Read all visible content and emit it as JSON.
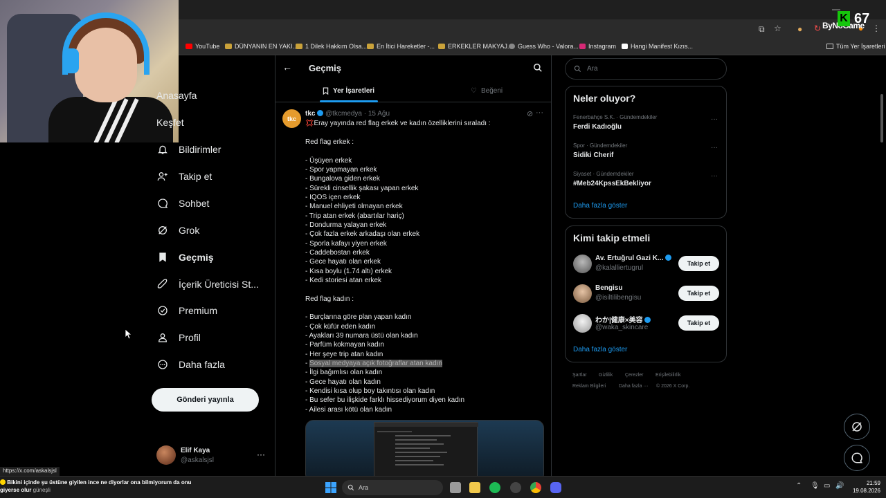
{
  "browser": {
    "bookmarks": [
      {
        "label": "YouTube",
        "color": "#ff0000"
      },
      {
        "label": "DÜNYANIN EN YAKI...",
        "color": "#caa23a"
      },
      {
        "label": "1 Dilek Hakkım Olsa...",
        "color": "#caa23a"
      },
      {
        "label": "En İtici Hareketler -...",
        "color": "#caa23a"
      },
      {
        "label": "ERKEKLER MAKYAJ...",
        "color": "#caa23a"
      },
      {
        "label": "Guess Who - Valora...",
        "color": "#888888"
      },
      {
        "label": "Instagram",
        "color": "#d62976"
      },
      {
        "label": "Hangi Manifest Kızıs...",
        "color": "#ffffff"
      }
    ],
    "all_bookmarks": "Tüm Yer İşaretleri",
    "status_url": "https://x.com/askalsjsl"
  },
  "overlay": {
    "brand": "ByNoGame",
    "score": "67"
  },
  "nav": {
    "items": [
      {
        "label": "Anasayfa",
        "icon": "home-icon"
      },
      {
        "label": "Keşfet",
        "icon": "search-icon"
      },
      {
        "label": "Bildirimler",
        "icon": "bell-icon"
      },
      {
        "label": "Takip et",
        "icon": "person-plus-icon"
      },
      {
        "label": "Sohbet",
        "icon": "chat-icon"
      },
      {
        "label": "Grok",
        "icon": "grok-icon"
      },
      {
        "label": "Geçmiş",
        "icon": "bookmark-icon"
      },
      {
        "label": "İçerik Üreticisi St...",
        "icon": "rocket-icon"
      },
      {
        "label": "Premium",
        "icon": "verified-icon"
      },
      {
        "label": "Profil",
        "icon": "person-icon"
      },
      {
        "label": "Daha fazla",
        "icon": "more-circle-icon"
      }
    ],
    "post_button": "Gönderi yayınla",
    "account": {
      "name": "Elif Kaya",
      "handle": "@askalsjsl"
    }
  },
  "main": {
    "title": "Geçmiş",
    "tabs": [
      "Yer İşaretleri",
      "Beğeni"
    ],
    "post": {
      "avatar_text": "tkc",
      "author": "tkc",
      "handle": "@tkcmedya",
      "date": "15 Ağu",
      "headline": "Eray yayında red flag erkek ve kadın özelliklerini sıraladı :",
      "section_men": "Red flag erkek :",
      "men": [
        "- Üşüyen erkek",
        "- Spor yapmayan erkek",
        "- Bungalova giden erkek",
        "- Sürekli cinsellik şakası yapan erkek",
        "- IQOS içen erkek",
        "- Manuel ehliyeti olmayan erkek",
        "- Trip atan erkek (abartılar hariç)",
        "- Dondurma yalayan erkek",
        "- Çok fazla erkek arkadaşı olan erkek",
        "- Sporla kafayı yiyen erkek",
        "- Caddebostan erkek",
        "- Gece hayatı olan erkek",
        "- Kısa boylu (1.74 altı) erkek",
        "- Kedi storiesi atan erkek"
      ],
      "section_women": "Red flag kadın :",
      "women": [
        "- Burçlarına göre plan yapan kadın",
        "- Çok küfür eden kadın",
        "- Ayakları 39 numara üstü olan kadın",
        "- Parfüm kokmayan kadın",
        "- Her şeye trip atan kadın"
      ],
      "highlighted_prefix": "- ",
      "highlighted_text": "Sosyal medyaya açık fotoğraflar atan kadın",
      "women_after": [
        "- İlgi bağımlısı olan kadın",
        "- Gece hayatı olan kadın",
        "- Kendisi kısa olup boy takıntısı olan kadın",
        "- Bu sefer bu ilişkide farklı hissediyorum diyen kadın",
        "- Ailesi arası kötü olan kadın"
      ]
    }
  },
  "right": {
    "search_placeholder": "Ara",
    "trends_title": "Neler oluyor?",
    "trends": [
      {
        "category": "Fenerbahçe S.K. · Gündemdekiler",
        "name": "Ferdi Kadıoğlu"
      },
      {
        "category": "Spor · Gündemdekiler",
        "name": "Sidiki Cherif"
      },
      {
        "category": "Siyaset · Gündemdekiler",
        "name": "#Meb24KpssEkBekliyor"
      }
    ],
    "show_more": "Daha fazla göster",
    "who_to_follow_title": "Kimi takip etmeli",
    "who_to_follow": [
      {
        "name": "Av. Ertuğrul Gazi K...",
        "handle": "@kalalliertugrul",
        "verified": true
      },
      {
        "name": "Bengisu",
        "handle": "@isiltilibengisu",
        "verified": false
      },
      {
        "name": "わか|健康×美容",
        "handle": "@waka_skincare",
        "verified": true
      }
    ],
    "follow_label": "Takip et",
    "footer": [
      "Şartlar",
      "Gizlilik",
      "Çerezler",
      "Erişilebilirlik",
      "Reklam Bilgileri",
      "Daha fazla ···",
      "© 2026 X Corp."
    ]
  },
  "taskbar": {
    "ticker_line1": "Bikini içinde şu üstüne giyilen ince ne diyorlar ona bilmiyorum da onu",
    "ticker_line2": "giyerse olur",
    "ticker_label": "güneşli",
    "search": "Ara",
    "time": "21:59",
    "date": "19.08.2026"
  },
  "colors": {
    "accent": "#1d9bf0",
    "background": "#000000",
    "border": "#2f3336",
    "muted": "#71767b"
  }
}
